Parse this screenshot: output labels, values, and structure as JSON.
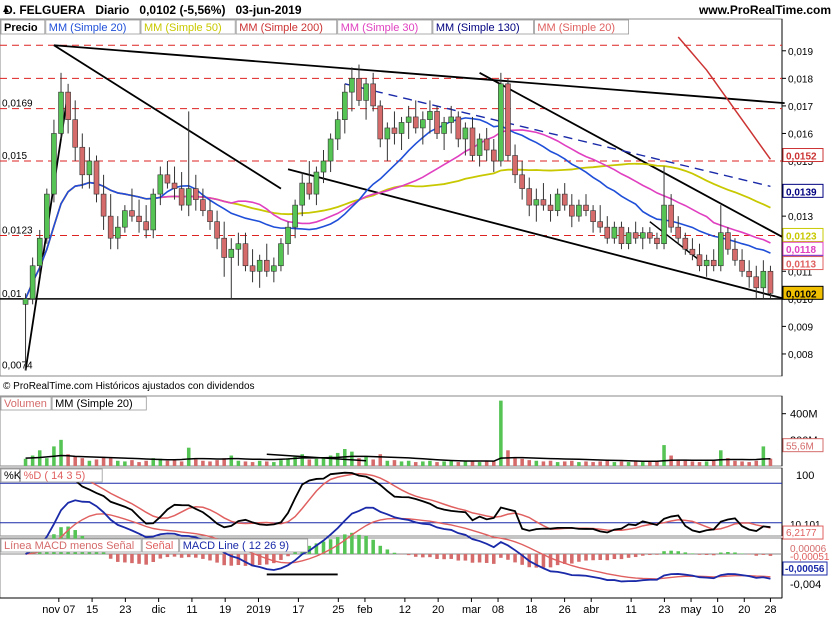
{
  "header": {
    "symbol": "D. FELGUERA",
    "period": "Diario",
    "last": "0,0102",
    "change": "(-5,56%)",
    "date": "03-jun-2019",
    "site": "www.ProRealTime.com"
  },
  "price_panel": {
    "labels": [
      "Precio",
      "MM (Simple 20)",
      "MM (Simple 50)",
      "MM (Simple 200)",
      "MM (Simple 30)",
      "MM (Simple 130)",
      "MM (Simple 20)"
    ],
    "label_colors": [
      "#000000",
      "#1f4fd8",
      "#c8c800",
      "#cc3333",
      "#e040c0",
      "#000080",
      "#e06060"
    ],
    "left_levels": [
      "0,0169",
      "0,015",
      "0,0123",
      "0,01",
      "0,0074"
    ],
    "axis_ticks": [
      "0,019",
      "0,018",
      "0,017",
      "0,016",
      "0,015",
      "0,014",
      "0,013",
      "0,012",
      "0,011",
      "0,010",
      "0,009",
      "0,008"
    ],
    "value_tags": [
      {
        "text": "0,0152",
        "color": "#cc3333",
        "y": 0.0152,
        "bg": "#ffffff"
      },
      {
        "text": "0,0139",
        "color": "#000080",
        "y": 0.0139,
        "bg": "#ffffff"
      },
      {
        "text": "0,0123",
        "color": "#c8c800",
        "y": 0.0123,
        "bg": "#ffffff"
      },
      {
        "text": "0,0118",
        "color": "#e040c0",
        "y": 0.0118,
        "bg": "#ffffff"
      },
      {
        "text": "0,0113",
        "color": "#1f4fd8",
        "y": 0.0113,
        "bg": "#ffffff"
      },
      {
        "text": "0,0113",
        "color": "#e06060",
        "y": 0.01128,
        "bg": "#ffffff"
      },
      {
        "text": "0,0102",
        "color": "#000000",
        "y": 0.0102,
        "bg": "#f0c000"
      }
    ],
    "copyright": "© ProRealTime.com  Históricos ajustados con dividendos"
  },
  "volume_panel": {
    "labels": [
      "Volumen",
      "MM (Simple 20)"
    ],
    "axis_ticks": [
      "400M",
      "200M"
    ],
    "value_tag": "55,6M"
  },
  "stoch_panel": {
    "labels": [
      "%K",
      "%D ( 14 3 5)"
    ],
    "axis_ticks": [
      "100",
      "0"
    ],
    "value_tags": [
      "10,101",
      "6,2177"
    ]
  },
  "macd_panel": {
    "labels": [
      "Línea MACD menos Señal",
      "Señal",
      "MACD Line ( 12 26 9)"
    ],
    "axis_ticks": [
      "-0,004"
    ],
    "value_tags": [
      "0,00006",
      "-0,00051",
      "-0,00056"
    ]
  },
  "x_axis": {
    "labels": [
      "nov 07",
      "15",
      "23",
      "dic",
      "11",
      "19",
      "2019",
      "17",
      "25",
      "feb",
      "12",
      "20",
      "mar",
      "08",
      "18",
      "26",
      "abr",
      "11",
      "23",
      "may",
      "10",
      "20",
      "28"
    ]
  },
  "chart_data": {
    "type": "candlestick",
    "title": "D. FELGUERA Diario 0,0102 (-5,56%) 03-jun-2019",
    "y_range": [
      0.0072,
      0.0195
    ],
    "ohlc": [
      [
        0.0098,
        0.0102,
        0.0074,
        0.01
      ],
      [
        0.01,
        0.0115,
        0.0098,
        0.0112
      ],
      [
        0.0112,
        0.0125,
        0.0108,
        0.0122
      ],
      [
        0.0122,
        0.014,
        0.012,
        0.0138
      ],
      [
        0.0138,
        0.0165,
        0.0135,
        0.016
      ],
      [
        0.016,
        0.0182,
        0.0158,
        0.0175
      ],
      [
        0.0175,
        0.0178,
        0.016,
        0.0165
      ],
      [
        0.0165,
        0.0172,
        0.015,
        0.0155
      ],
      [
        0.0155,
        0.016,
        0.014,
        0.0145
      ],
      [
        0.0145,
        0.0155,
        0.014,
        0.015
      ],
      [
        0.015,
        0.0152,
        0.0135,
        0.0138
      ],
      [
        0.0138,
        0.0145,
        0.0125,
        0.013
      ],
      [
        0.013,
        0.0138,
        0.0118,
        0.0122
      ],
      [
        0.0122,
        0.013,
        0.0118,
        0.0126
      ],
      [
        0.0126,
        0.0134,
        0.0124,
        0.0132
      ],
      [
        0.0132,
        0.014,
        0.0128,
        0.013
      ],
      [
        0.013,
        0.0136,
        0.0124,
        0.0128
      ],
      [
        0.0128,
        0.0134,
        0.0122,
        0.0125
      ],
      [
        0.0125,
        0.014,
        0.0122,
        0.0138
      ],
      [
        0.0138,
        0.0148,
        0.0134,
        0.0145
      ],
      [
        0.0145,
        0.015,
        0.014,
        0.0142
      ],
      [
        0.0142,
        0.0148,
        0.0136,
        0.014
      ],
      [
        0.014,
        0.0146,
        0.0132,
        0.0134
      ],
      [
        0.0134,
        0.0168,
        0.013,
        0.014
      ],
      [
        0.014,
        0.0145,
        0.0132,
        0.0136
      ],
      [
        0.0136,
        0.014,
        0.013,
        0.0132
      ],
      [
        0.0132,
        0.0136,
        0.0125,
        0.0128
      ],
      [
        0.0128,
        0.0132,
        0.0118,
        0.0122
      ],
      [
        0.0122,
        0.0128,
        0.0108,
        0.0115
      ],
      [
        0.0115,
        0.0122,
        0.01,
        0.0118
      ],
      [
        0.0118,
        0.0124,
        0.0112,
        0.012
      ],
      [
        0.012,
        0.0124,
        0.011,
        0.0112
      ],
      [
        0.0112,
        0.0118,
        0.0106,
        0.011
      ],
      [
        0.011,
        0.0116,
        0.0104,
        0.0114
      ],
      [
        0.0114,
        0.012,
        0.0108,
        0.011
      ],
      [
        0.011,
        0.0115,
        0.0106,
        0.0112
      ],
      [
        0.0112,
        0.0122,
        0.011,
        0.012
      ],
      [
        0.012,
        0.0128,
        0.0116,
        0.0126
      ],
      [
        0.0126,
        0.0136,
        0.0122,
        0.0134
      ],
      [
        0.0134,
        0.0146,
        0.013,
        0.0142
      ],
      [
        0.0142,
        0.015,
        0.0136,
        0.0138
      ],
      [
        0.0138,
        0.0148,
        0.0134,
        0.0146
      ],
      [
        0.0146,
        0.0154,
        0.0142,
        0.015
      ],
      [
        0.015,
        0.016,
        0.0146,
        0.0158
      ],
      [
        0.0158,
        0.0168,
        0.0154,
        0.0165
      ],
      [
        0.0165,
        0.0178,
        0.016,
        0.0175
      ],
      [
        0.0175,
        0.0184,
        0.0168,
        0.018
      ],
      [
        0.018,
        0.0185,
        0.017,
        0.0172
      ],
      [
        0.0172,
        0.018,
        0.0165,
        0.0178
      ],
      [
        0.0178,
        0.0182,
        0.0168,
        0.017
      ],
      [
        0.017,
        0.0172,
        0.0155,
        0.0158
      ],
      [
        0.0158,
        0.0164,
        0.015,
        0.0162
      ],
      [
        0.0162,
        0.0168,
        0.0156,
        0.016
      ],
      [
        0.016,
        0.0166,
        0.0154,
        0.0164
      ],
      [
        0.0164,
        0.017,
        0.0158,
        0.0166
      ],
      [
        0.0166,
        0.0172,
        0.016,
        0.0162
      ],
      [
        0.0162,
        0.0168,
        0.0156,
        0.0165
      ],
      [
        0.0165,
        0.0172,
        0.016,
        0.0168
      ],
      [
        0.0168,
        0.017,
        0.0158,
        0.016
      ],
      [
        0.016,
        0.0166,
        0.0154,
        0.0164
      ],
      [
        0.0164,
        0.017,
        0.016,
        0.0166
      ],
      [
        0.0166,
        0.0168,
        0.0155,
        0.0158
      ],
      [
        0.0158,
        0.0164,
        0.0152,
        0.0162
      ],
      [
        0.0162,
        0.0166,
        0.015,
        0.0152
      ],
      [
        0.0152,
        0.016,
        0.0148,
        0.0158
      ],
      [
        0.0158,
        0.0162,
        0.015,
        0.0154
      ],
      [
        0.0154,
        0.0158,
        0.0146,
        0.015
      ],
      [
        0.015,
        0.0182,
        0.0148,
        0.0178
      ],
      [
        0.0178,
        0.018,
        0.015,
        0.0152
      ],
      [
        0.0152,
        0.0156,
        0.0142,
        0.0145
      ],
      [
        0.0145,
        0.015,
        0.0136,
        0.014
      ],
      [
        0.014,
        0.0144,
        0.013,
        0.0134
      ],
      [
        0.0134,
        0.014,
        0.0128,
        0.0136
      ],
      [
        0.0136,
        0.0142,
        0.0132,
        0.0134
      ],
      [
        0.0134,
        0.0138,
        0.0128,
        0.0132
      ],
      [
        0.0132,
        0.014,
        0.013,
        0.0138
      ],
      [
        0.0138,
        0.0142,
        0.0132,
        0.0134
      ],
      [
        0.0134,
        0.0138,
        0.0126,
        0.013
      ],
      [
        0.013,
        0.0136,
        0.0128,
        0.0134
      ],
      [
        0.0134,
        0.0138,
        0.013,
        0.0132
      ],
      [
        0.0132,
        0.0134,
        0.0124,
        0.0128
      ],
      [
        0.0128,
        0.0134,
        0.0124,
        0.0126
      ],
      [
        0.0126,
        0.013,
        0.012,
        0.0122
      ],
      [
        0.0122,
        0.0128,
        0.012,
        0.0126
      ],
      [
        0.0126,
        0.0128,
        0.0118,
        0.012
      ],
      [
        0.012,
        0.0126,
        0.0118,
        0.0124
      ],
      [
        0.0124,
        0.0128,
        0.012,
        0.0122
      ],
      [
        0.0122,
        0.0126,
        0.0118,
        0.0124
      ],
      [
        0.0124,
        0.0126,
        0.012,
        0.0122
      ],
      [
        0.0122,
        0.0124,
        0.0118,
        0.012
      ],
      [
        0.012,
        0.0148,
        0.0118,
        0.0134
      ],
      [
        0.0134,
        0.0138,
        0.0124,
        0.0126
      ],
      [
        0.0126,
        0.013,
        0.012,
        0.0122
      ],
      [
        0.0122,
        0.0124,
        0.0116,
        0.0118
      ],
      [
        0.0118,
        0.0122,
        0.0114,
        0.0116
      ],
      [
        0.0116,
        0.012,
        0.011,
        0.0112
      ],
      [
        0.0112,
        0.0116,
        0.0108,
        0.0114
      ],
      [
        0.0114,
        0.0118,
        0.011,
        0.0112
      ],
      [
        0.0112,
        0.0134,
        0.011,
        0.0124
      ],
      [
        0.0124,
        0.0126,
        0.0116,
        0.0118
      ],
      [
        0.0118,
        0.0122,
        0.0112,
        0.0114
      ],
      [
        0.0114,
        0.0118,
        0.0108,
        0.011
      ],
      [
        0.011,
        0.0114,
        0.0104,
        0.0108
      ],
      [
        0.0108,
        0.0112,
        0.01,
        0.0104
      ],
      [
        0.0104,
        0.0114,
        0.01,
        0.011
      ],
      [
        0.011,
        0.0112,
        0.01,
        0.0102
      ]
    ],
    "volume": [
      55,
      80,
      120,
      60,
      150,
      200,
      90,
      70,
      60,
      40,
      50,
      70,
      60,
      40,
      35,
      45,
      30,
      40,
      60,
      55,
      40,
      45,
      35,
      140,
      50,
      40,
      35,
      45,
      60,
      80,
      40,
      35,
      30,
      40,
      35,
      30,
      45,
      60,
      70,
      90,
      50,
      55,
      60,
      80,
      100,
      130,
      110,
      60,
      70,
      50,
      90,
      40,
      45,
      35,
      40,
      30,
      35,
      40,
      30,
      35,
      40,
      30,
      35,
      40,
      30,
      35,
      40,
      500,
      120,
      60,
      55,
      45,
      40,
      35,
      40,
      30,
      35,
      40,
      30,
      35,
      30,
      35,
      40,
      30,
      35,
      30,
      35,
      30,
      35,
      40,
      160,
      80,
      45,
      40,
      35,
      30,
      35,
      40,
      120,
      60,
      40,
      35,
      30,
      40,
      150,
      56
    ],
    "vol_ma20": [
      60,
      62,
      65,
      70,
      75,
      80,
      78,
      74,
      72,
      70,
      68,
      66,
      64,
      62,
      60,
      58,
      56,
      54,
      52,
      50,
      48,
      48,
      50,
      54,
      56,
      56,
      55,
      54,
      54,
      56,
      56,
      54,
      52,
      52,
      50,
      50,
      52,
      54,
      58,
      62,
      62,
      62,
      63,
      64,
      66,
      70,
      74,
      74,
      74,
      72,
      70,
      68,
      66,
      64,
      62,
      58,
      55,
      52,
      48,
      45,
      42,
      40,
      38,
      38,
      38,
      38,
      37,
      60,
      62,
      64,
      64,
      62,
      60,
      58,
      56,
      55,
      54,
      53,
      52,
      50,
      48,
      46,
      44,
      43,
      42,
      40,
      38,
      36,
      36,
      36,
      40,
      44,
      45,
      45,
      44,
      44,
      44,
      44,
      48,
      50,
      50,
      50,
      49,
      50,
      54,
      55
    ]
  }
}
